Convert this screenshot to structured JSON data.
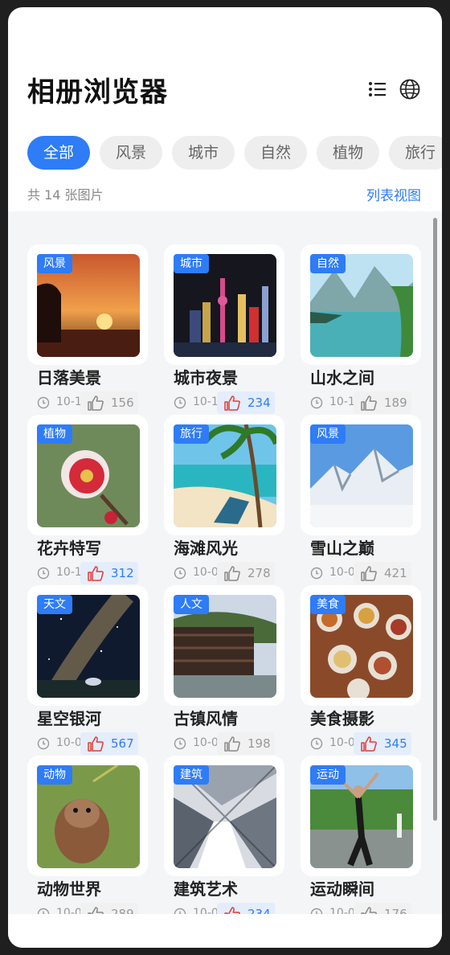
{
  "header": {
    "title": "相册浏览器",
    "list_icon": "list-icon",
    "globe_icon": "globe-icon"
  },
  "tabs": [
    {
      "label": "全部",
      "active": true
    },
    {
      "label": "风景",
      "active": false
    },
    {
      "label": "城市",
      "active": false
    },
    {
      "label": "自然",
      "active": false
    },
    {
      "label": "植物",
      "active": false
    },
    {
      "label": "旅行",
      "active": false
    }
  ],
  "summary": {
    "count_text": "共 14 张图片",
    "view_toggle": "列表视图"
  },
  "colors": {
    "accent": "#2e7cf6",
    "liked": "#e53935"
  },
  "photos": [
    {
      "tag": "风景",
      "title": "日落美景",
      "date": "10-1",
      "likes": "156",
      "liked": false
    },
    {
      "tag": "城市",
      "title": "城市夜景",
      "date": "10-1",
      "likes": "234",
      "liked": true
    },
    {
      "tag": "自然",
      "title": "山水之间",
      "date": "10-1",
      "likes": "189",
      "liked": false
    },
    {
      "tag": "植物",
      "title": "花卉特写",
      "date": "10-1",
      "likes": "312",
      "liked": true
    },
    {
      "tag": "旅行",
      "title": "海滩风光",
      "date": "10-0",
      "likes": "278",
      "liked": false
    },
    {
      "tag": "风景",
      "title": "雪山之巅",
      "date": "10-0",
      "likes": "421",
      "liked": false
    },
    {
      "tag": "天文",
      "title": "星空银河",
      "date": "10-0",
      "likes": "567",
      "liked": true
    },
    {
      "tag": "人文",
      "title": "古镇风情",
      "date": "10-0",
      "likes": "198",
      "liked": false
    },
    {
      "tag": "美食",
      "title": "美食摄影",
      "date": "10-0",
      "likes": "345",
      "liked": true
    },
    {
      "tag": "动物",
      "title": "动物世界",
      "date": "10-0",
      "likes": "289",
      "liked": false
    },
    {
      "tag": "建筑",
      "title": "建筑艺术",
      "date": "10-0",
      "likes": "234",
      "liked": true
    },
    {
      "tag": "运动",
      "title": "运动瞬间",
      "date": "10-0",
      "likes": "176",
      "liked": false
    }
  ]
}
